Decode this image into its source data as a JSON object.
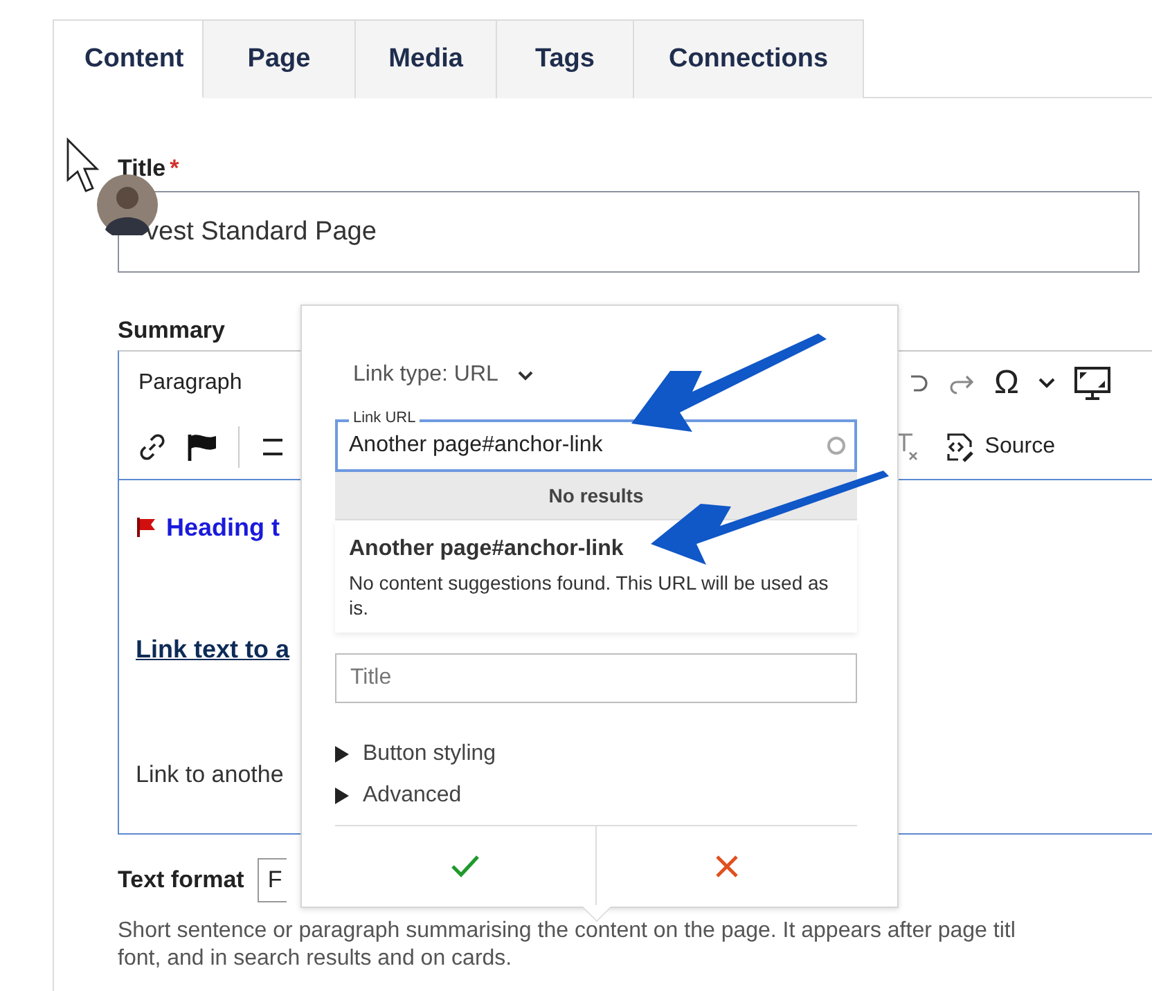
{
  "tabs": [
    {
      "label": "Content",
      "selected": true
    },
    {
      "label": "Page",
      "selected": false
    },
    {
      "label": "Media",
      "selected": false
    },
    {
      "label": "Tags",
      "selected": false
    },
    {
      "label": "Connections",
      "selected": false
    }
  ],
  "title_field": {
    "label": "Title",
    "required_mark": "*",
    "value": "vest Standard Page"
  },
  "summary": {
    "label": "Summary",
    "block_format": "Paragraph",
    "special_characters": "Ω",
    "source_button": "Source",
    "content": [
      {
        "kind": "heading",
        "text": "Heading t"
      },
      {
        "kind": "link",
        "text": "Link text to a"
      },
      {
        "kind": "paragraph",
        "text": "Link to anothe"
      }
    ]
  },
  "text_format": {
    "label": "Text format",
    "value": "F"
  },
  "help_text": [
    "Short sentence or paragraph summarising the content on the page. It appears after page titl",
    "font, and in search results and on cards."
  ],
  "link_popover": {
    "link_type": "Link type: URL",
    "url_field": {
      "label": "Link URL",
      "value": "Another page#anchor-link"
    },
    "results_header": "No results",
    "suggestion": {
      "title": "Another page#anchor-link",
      "description": "No content suggestions found. This URL will be used as is."
    },
    "title_field": {
      "placeholder": "Title"
    },
    "sections": [
      {
        "label": "Button styling",
        "expanded": false
      },
      {
        "label": "Advanced",
        "expanded": false
      }
    ]
  }
}
